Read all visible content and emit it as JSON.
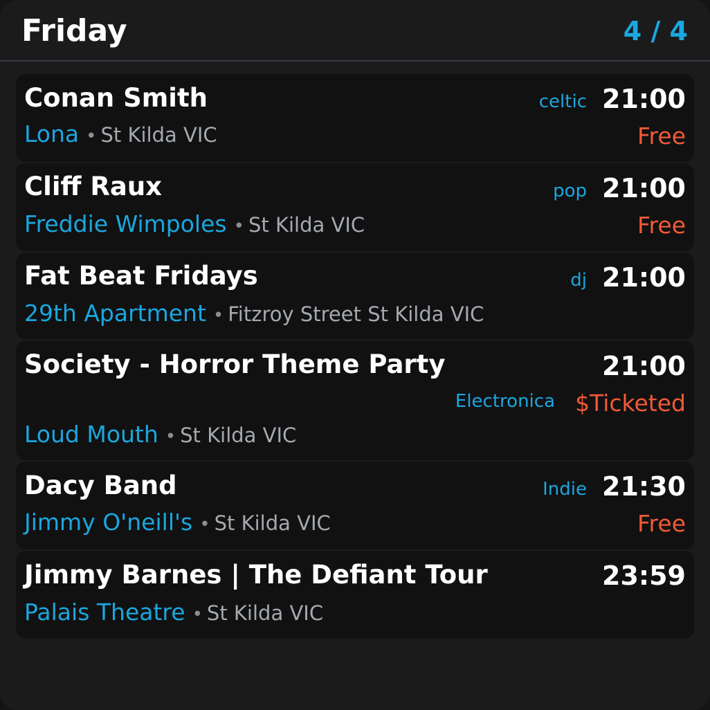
{
  "header": {
    "day": "Friday",
    "page": "4 / 4"
  },
  "separator": "•",
  "events": [
    {
      "title": "Conan Smith",
      "genre": "celtic",
      "time": "21:00",
      "venue": "Lona",
      "location": "St Kilda VIC",
      "price": "Free"
    },
    {
      "title": "Cliff Raux",
      "genre": "pop",
      "time": "21:00",
      "venue": "Freddie Wimpoles",
      "location": "St Kilda VIC",
      "price": "Free"
    },
    {
      "title": "Fat Beat Fridays",
      "genre": "dj",
      "time": "21:00",
      "venue": "29th Apartment",
      "location": "Fitzroy Street St Kilda VIC",
      "price": ""
    },
    {
      "title": "Society - Horror Theme Party",
      "genre": "Electronica",
      "time": "21:00",
      "venue": "Loud Mouth",
      "location": "St Kilda VIC",
      "price": "$Ticketed"
    },
    {
      "title": "Dacy Band",
      "genre": "Indie",
      "time": "21:30",
      "venue": "Jimmy O'neill's",
      "location": "St Kilda VIC",
      "price": "Free"
    },
    {
      "title": "Jimmy Barnes | The Defiant Tour",
      "genre": "",
      "time": "23:59",
      "venue": "Palais Theatre",
      "location": "St Kilda VIC",
      "price": ""
    }
  ]
}
